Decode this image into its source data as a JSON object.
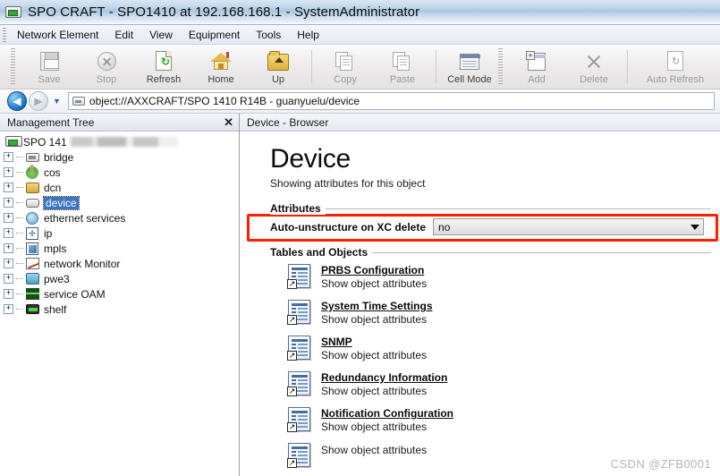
{
  "window": {
    "title": "SPO CRAFT - SPO1410 at 192.168.168.1 - SystemAdministrator",
    "icon": "device-rack-icon"
  },
  "menubar": {
    "items": [
      {
        "label": "Network Element"
      },
      {
        "label": "Edit"
      },
      {
        "label": "View"
      },
      {
        "label": "Equipment"
      },
      {
        "label": "Tools"
      },
      {
        "label": "Help"
      }
    ]
  },
  "toolbar": {
    "buttons": [
      {
        "label": "Save",
        "icon": "save-icon",
        "enabled": false
      },
      {
        "label": "Stop",
        "icon": "stop-icon",
        "enabled": false
      },
      {
        "label": "Refresh",
        "icon": "refresh-icon",
        "enabled": true
      },
      {
        "label": "Home",
        "icon": "home-icon",
        "enabled": true
      },
      {
        "label": "Up",
        "icon": "folder-up-icon",
        "enabled": true
      },
      {
        "label": "Copy",
        "icon": "copy-icon",
        "enabled": false
      },
      {
        "label": "Paste",
        "icon": "paste-icon",
        "enabled": false
      },
      {
        "label": "Cell Mode",
        "icon": "cell-mode-icon",
        "enabled": true
      },
      {
        "label": "Add",
        "icon": "add-icon",
        "enabled": false
      },
      {
        "label": "Delete",
        "icon": "delete-icon",
        "enabled": false
      },
      {
        "label": "Auto Refresh",
        "icon": "auto-refresh-icon",
        "enabled": false
      }
    ]
  },
  "addressbar": {
    "back_icon": "back-arrow-icon",
    "forward_icon": "forward-arrow-icon",
    "history_icon": "chevron-down-icon",
    "location_icon": "device-icon",
    "value": "object://AXXCRAFT/SPO 1410 R14B - guanyuelu/device"
  },
  "tree_panel": {
    "title": "Management Tree",
    "close_icon": "close-icon",
    "root": {
      "label": "SPO 141",
      "icon": "device-rack-icon",
      "redacted": true
    },
    "items": [
      {
        "label": "bridge",
        "icon": "bridge-icon",
        "expander": "+",
        "selected": false
      },
      {
        "label": "cos",
        "icon": "cos-icon",
        "expander": "+",
        "selected": false
      },
      {
        "label": "dcn",
        "icon": "dcn-icon",
        "expander": "+",
        "selected": false
      },
      {
        "label": "device",
        "icon": "device-icon",
        "expander": "+",
        "selected": true
      },
      {
        "label": "ethernet services",
        "icon": "ethernet-services-icon",
        "expander": "+",
        "selected": false
      },
      {
        "label": "ip",
        "icon": "ip-icon",
        "expander": "+",
        "selected": false
      },
      {
        "label": "mpls",
        "icon": "mpls-icon",
        "expander": "+",
        "selected": false
      },
      {
        "label": "network Monitor",
        "icon": "network-monitor-icon",
        "expander": "+",
        "selected": false
      },
      {
        "label": "pwe3",
        "icon": "pwe3-icon",
        "expander": "+",
        "selected": false
      },
      {
        "label": "service OAM",
        "icon": "service-oam-icon",
        "expander": "+",
        "selected": false
      },
      {
        "label": "shelf",
        "icon": "shelf-icon",
        "expander": "+",
        "selected": false
      }
    ]
  },
  "browser": {
    "header_title": "Device - Browser",
    "page_title": "Device",
    "page_subtitle": "Showing attributes for this object",
    "attributes_group_label": "Attributes",
    "attributes": [
      {
        "label": "Auto-unstructure on XC delete",
        "value": "no",
        "control": "dropdown",
        "highlighted": true
      }
    ],
    "tables_group_label": "Tables and Objects",
    "objects": [
      {
        "link": "PRBS Configuration",
        "desc": "Show object attributes",
        "icon": "table-object-icon"
      },
      {
        "link": "System Time Settings",
        "desc": "Show object attributes",
        "icon": "table-object-icon"
      },
      {
        "link": "SNMP",
        "desc": "Show object attributes",
        "icon": "table-object-icon"
      },
      {
        "link": "Redundancy Information",
        "desc": "Show object attributes",
        "icon": "table-object-icon"
      },
      {
        "link": "Notification Configuration",
        "desc": "Show object attributes",
        "icon": "table-object-icon"
      },
      {
        "link": "",
        "desc": "Show object attributes",
        "icon": "table-object-icon"
      }
    ]
  },
  "watermark": {
    "text": "CSDN @ZFB0001"
  },
  "colors": {
    "highlight_red": "#ff1f00",
    "selection_blue": "#3a74c4",
    "titlebar_blue": "#a8c6e0",
    "link_text": "#0a0a0a"
  }
}
